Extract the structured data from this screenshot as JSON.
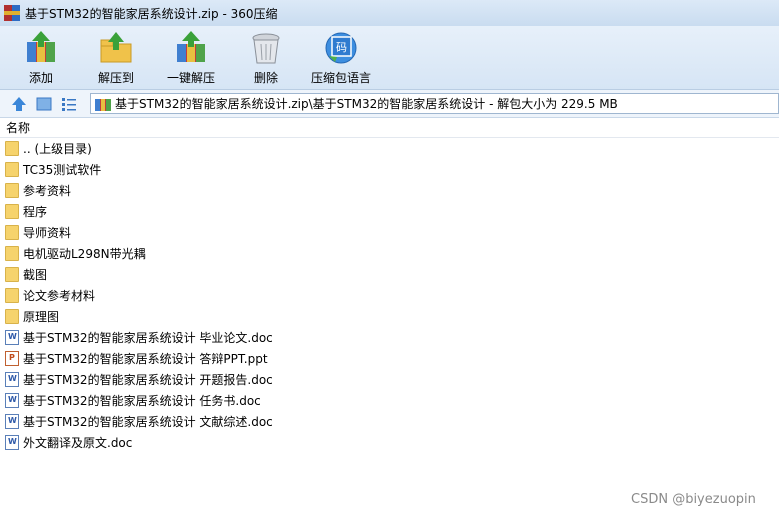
{
  "window": {
    "title": "基于STM32的智能家居系统设计.zip - 360压缩"
  },
  "toolbar": {
    "items": [
      {
        "label": "添加",
        "icon": "add-archive-icon"
      },
      {
        "label": "解压到",
        "icon": "extract-to-icon"
      },
      {
        "label": "一键解压",
        "icon": "one-click-extract-icon"
      },
      {
        "label": "删除",
        "icon": "delete-trash-icon"
      },
      {
        "label": "压缩包语言",
        "icon": "archive-language-icon"
      }
    ]
  },
  "address": {
    "path": "基于STM32的智能家居系统设计.zip\\基于STM32的智能家居系统设计 - 解包大小为 229.5 MB"
  },
  "list": {
    "column_name": "名称",
    "rows": [
      {
        "name": ".. (上级目录)",
        "type": "folder"
      },
      {
        "name": "TC35测试软件",
        "type": "folder"
      },
      {
        "name": "参考资料",
        "type": "folder"
      },
      {
        "name": "程序",
        "type": "folder"
      },
      {
        "name": "导师资料",
        "type": "folder"
      },
      {
        "name": "电机驱动L298N带光耦",
        "type": "folder"
      },
      {
        "name": "截图",
        "type": "folder"
      },
      {
        "name": "论文参考材料",
        "type": "folder"
      },
      {
        "name": "原理图",
        "type": "folder"
      },
      {
        "name": "基于STM32的智能家居系统设计 毕业论文.doc",
        "type": "doc"
      },
      {
        "name": "基于STM32的智能家居系统设计 答辩PPT.ppt",
        "type": "ppt"
      },
      {
        "name": "基于STM32的智能家居系统设计 开题报告.doc",
        "type": "doc"
      },
      {
        "name": "基于STM32的智能家居系统设计 任务书.doc",
        "type": "doc"
      },
      {
        "name": "基于STM32的智能家居系统设计 文献综述.doc",
        "type": "doc"
      },
      {
        "name": "外文翻译及原文.doc",
        "type": "doc"
      }
    ]
  },
  "watermark": "CSDN @biyezuopin"
}
